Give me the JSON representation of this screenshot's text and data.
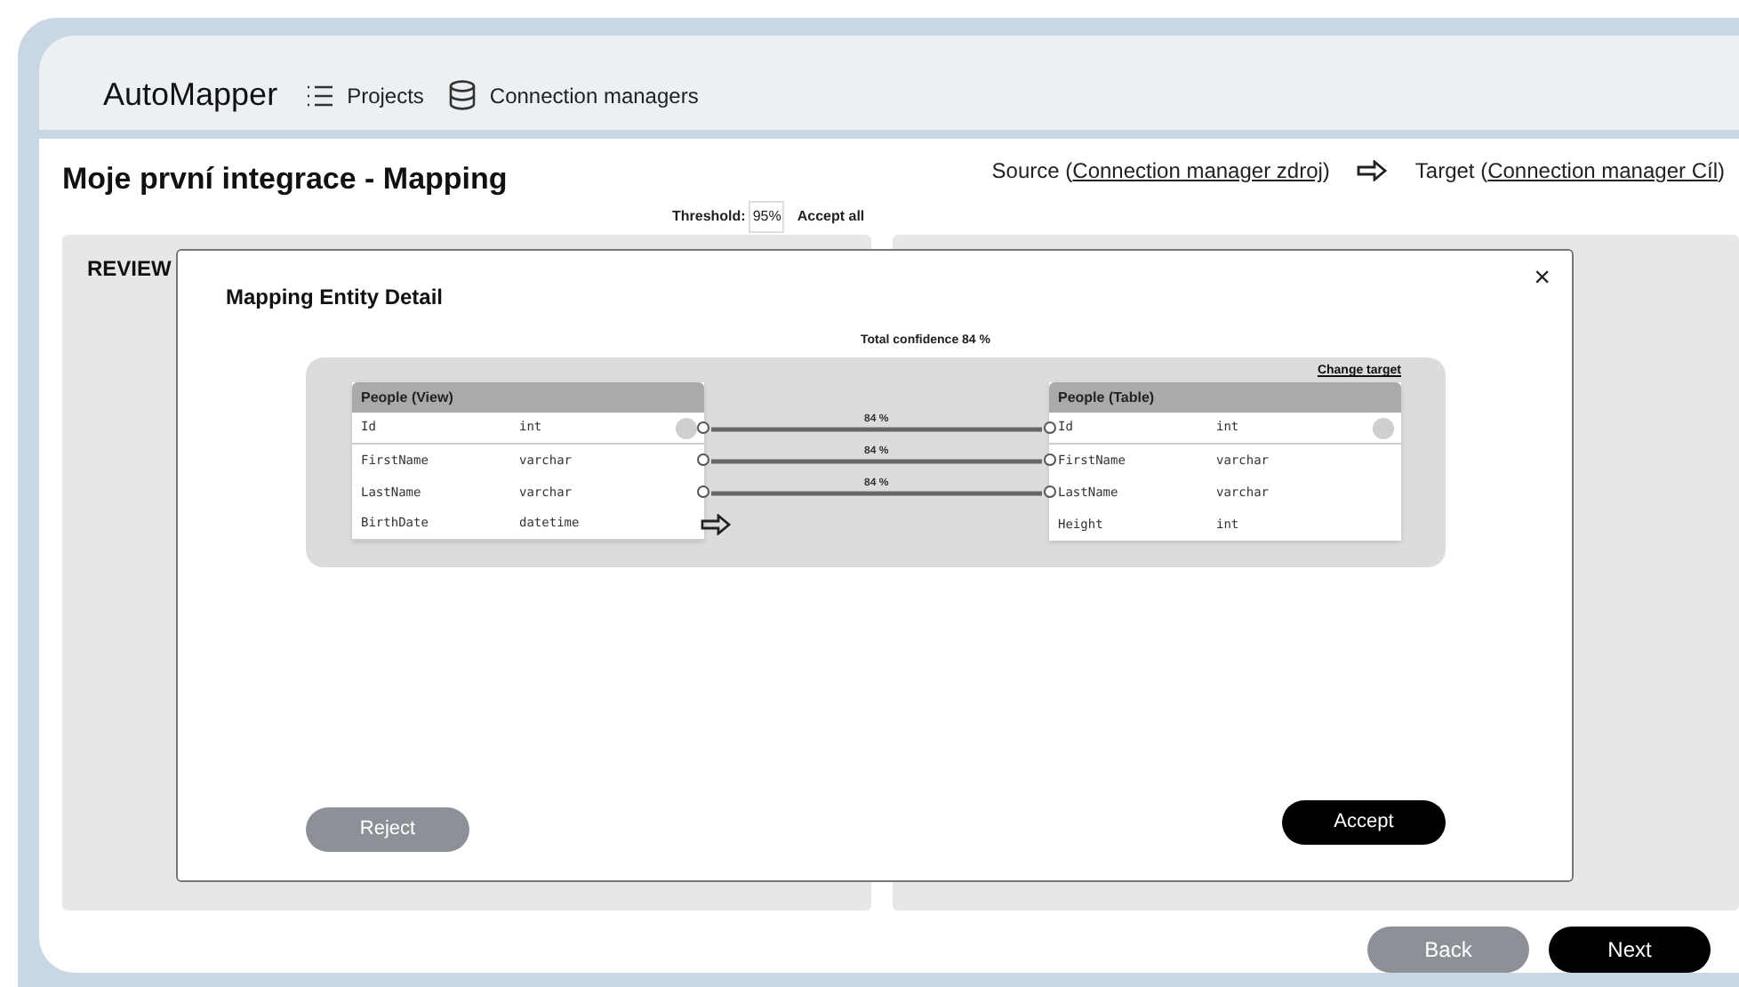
{
  "nav": {
    "app_name": "AutoMapper",
    "items": [
      {
        "label": "Projects",
        "kind": "list"
      },
      {
        "label": "Connection managers",
        "kind": "database"
      }
    ]
  },
  "page": {
    "title": "Moje první integrace - Mapping",
    "source_label": "Source (",
    "source_link": "Connection manager zdroj",
    "source_close": ")",
    "target_label": "Target (",
    "target_link": "Connection manager Cíl",
    "target_close": ")",
    "threshold_label": "Threshold:",
    "threshold_value": "95%",
    "accept_all": "Accept all"
  },
  "panels": [
    {
      "heading": "REVIEW"
    }
  ],
  "modal": {
    "title": "Mapping Entity Detail",
    "close": "×",
    "total_confidence": "Total confidence 84 %",
    "change_target": "Change target",
    "source_table": {
      "title": "People (View)",
      "columns": [
        {
          "name": "Id",
          "type": "int",
          "pk": true,
          "mapped": true
        },
        {
          "name": "FirstName",
          "type": "varchar",
          "pk": false,
          "mapped": true
        },
        {
          "name": "LastName",
          "type": "varchar",
          "pk": false,
          "mapped": true
        },
        {
          "name": "BirthDate",
          "type": "datetime",
          "pk": false,
          "mapped": false
        }
      ]
    },
    "target_table": {
      "title": "People (Table)",
      "columns": [
        {
          "name": "Id",
          "type": "int",
          "pk": true,
          "mapped": true
        },
        {
          "name": "FirstName",
          "type": "varchar",
          "pk": false,
          "mapped": true
        },
        {
          "name": "LastName",
          "type": "varchar",
          "pk": false,
          "mapped": true
        },
        {
          "name": "Height",
          "type": "int",
          "pk": false,
          "mapped": false
        }
      ]
    },
    "mappings": [
      {
        "confidence": "84 %"
      },
      {
        "confidence": "84 %"
      },
      {
        "confidence": "84 %"
      }
    ],
    "reject": "Reject",
    "accept": "Accept"
  },
  "footer": {
    "back": "Back",
    "next": "Next"
  }
}
